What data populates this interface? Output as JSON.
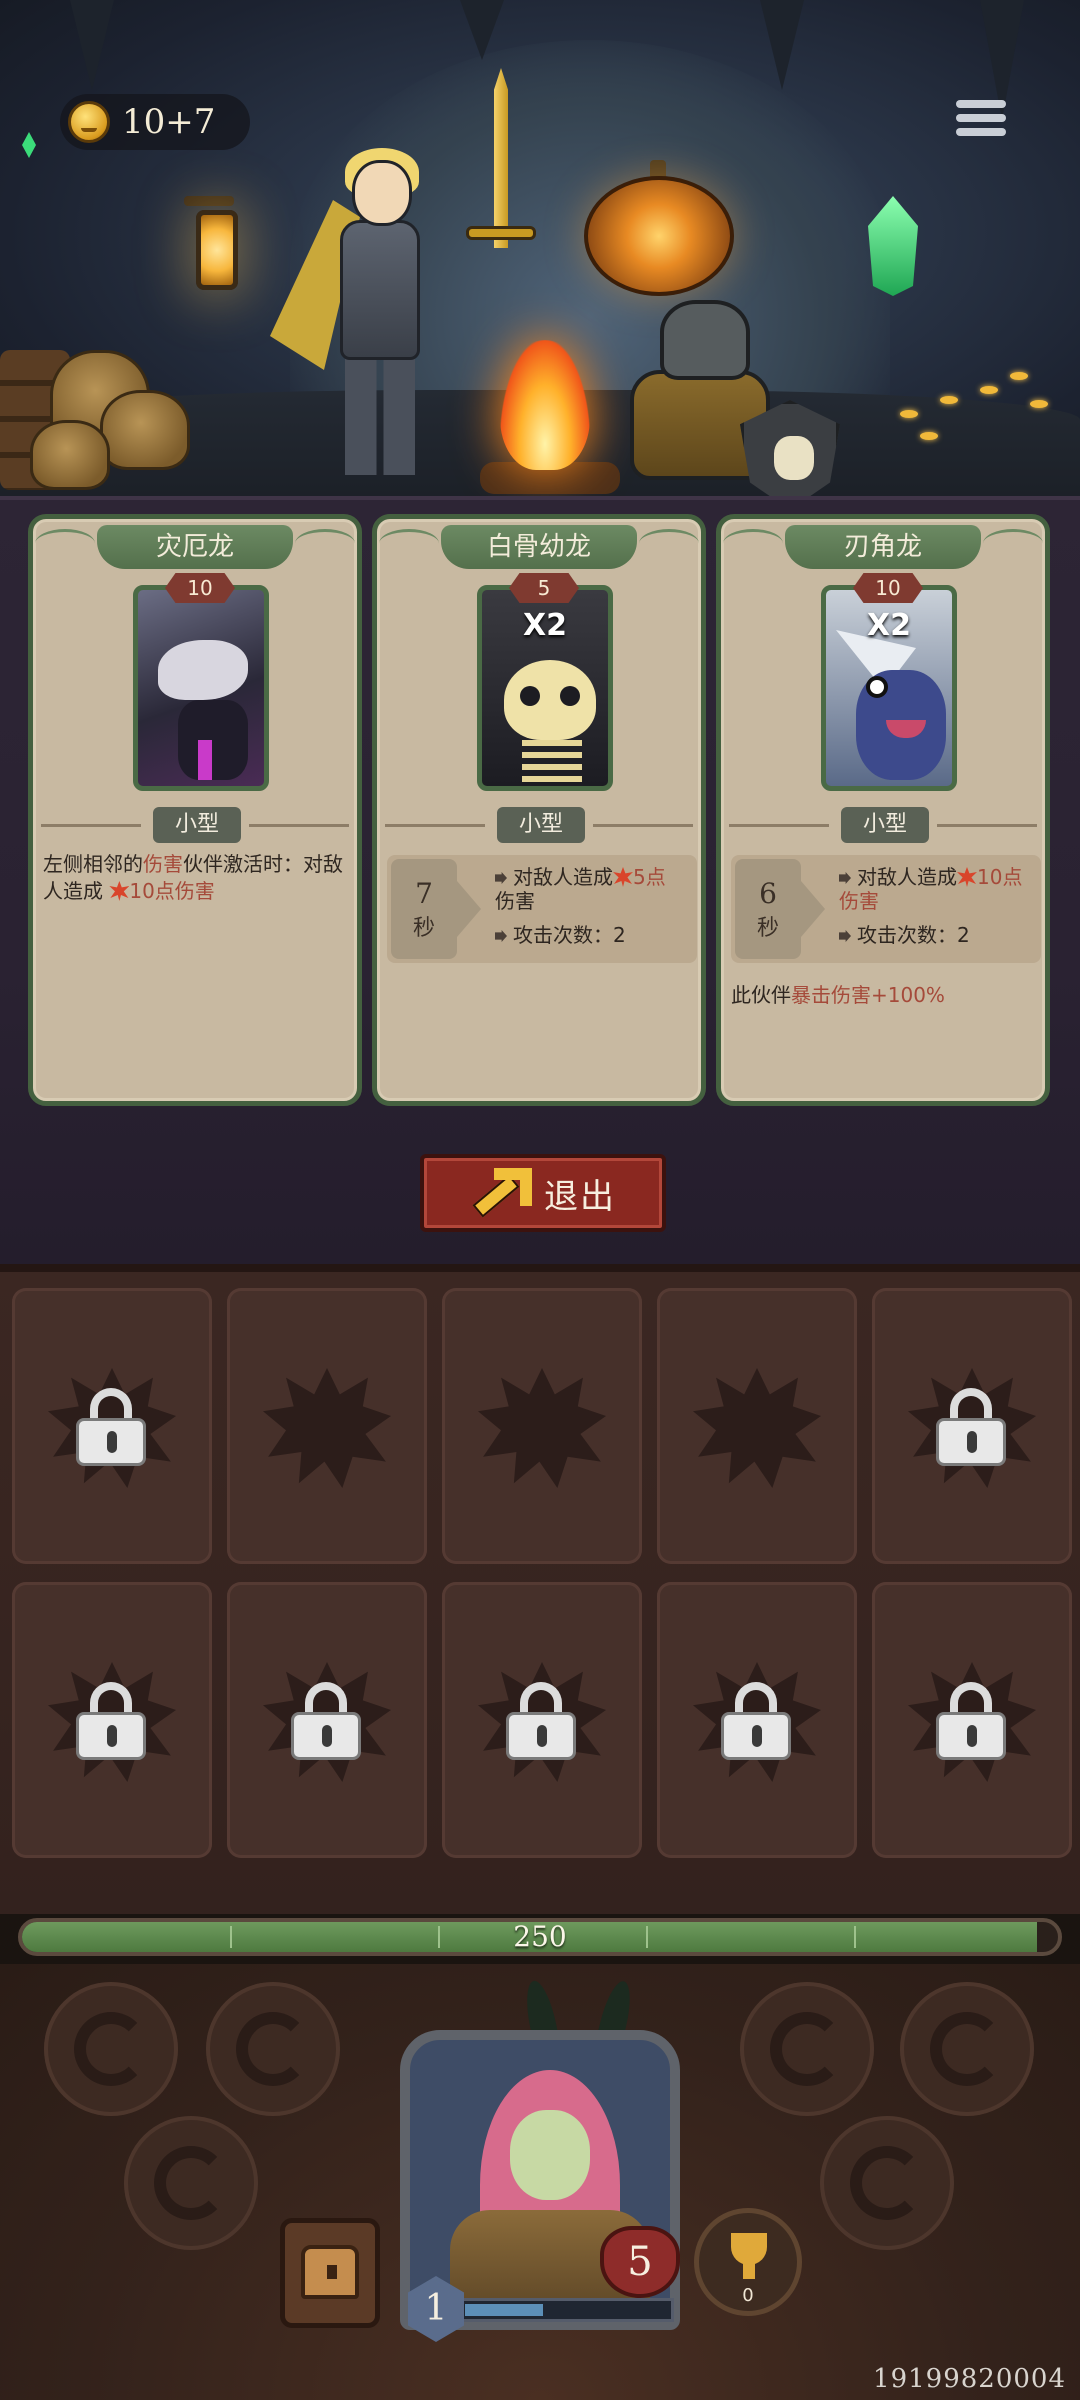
{
  "hud": {
    "gold": "10+7"
  },
  "cards": [
    {
      "name": "灾厄龙",
      "cost": "10",
      "multiplier": "",
      "size": "小型",
      "desc_pre": "左侧相邻的",
      "desc_hl": "伤害",
      "desc_mid": "伙伴激活时：对敌人造成",
      "desc_dmg": "10点伤害"
    },
    {
      "name": "白骨幼龙",
      "cost": "5",
      "multiplier": "X2",
      "size": "小型",
      "timer": "7",
      "timer_unit": "秒",
      "stat1_pre": "对敌人造成",
      "stat1_dmg": "5点",
      "stat1_post": "伤害",
      "stat2": "攻击次数：2"
    },
    {
      "name": "刃角龙",
      "cost": "10",
      "multiplier": "X2",
      "size": "小型",
      "timer": "6",
      "timer_unit": "秒",
      "stat1_pre": "对敌人造成",
      "stat1_dmg": "10点",
      "stat1_post": "伤害",
      "stat2": "攻击次数：2",
      "extra_pre": "此伙伴",
      "extra_hl": "暴击伤害",
      "extra_post": "+100%"
    }
  ],
  "exit_label": "退出",
  "inventory": {
    "locked_slots": [
      0,
      4,
      5,
      6,
      7,
      8,
      9
    ],
    "total_slots": 10
  },
  "hp": {
    "value": "250",
    "fraction": 0.98
  },
  "player": {
    "level": "1",
    "health": "5",
    "xp_segments_filled": 3,
    "xp_segments_total": 8,
    "trophies": "0"
  },
  "build_id": "19199820004",
  "colors": {
    "card_border": "#44603f",
    "exit_button": "#8a2820",
    "hp_fill": "#4e7a40",
    "damage_text": "#a54a3a"
  }
}
